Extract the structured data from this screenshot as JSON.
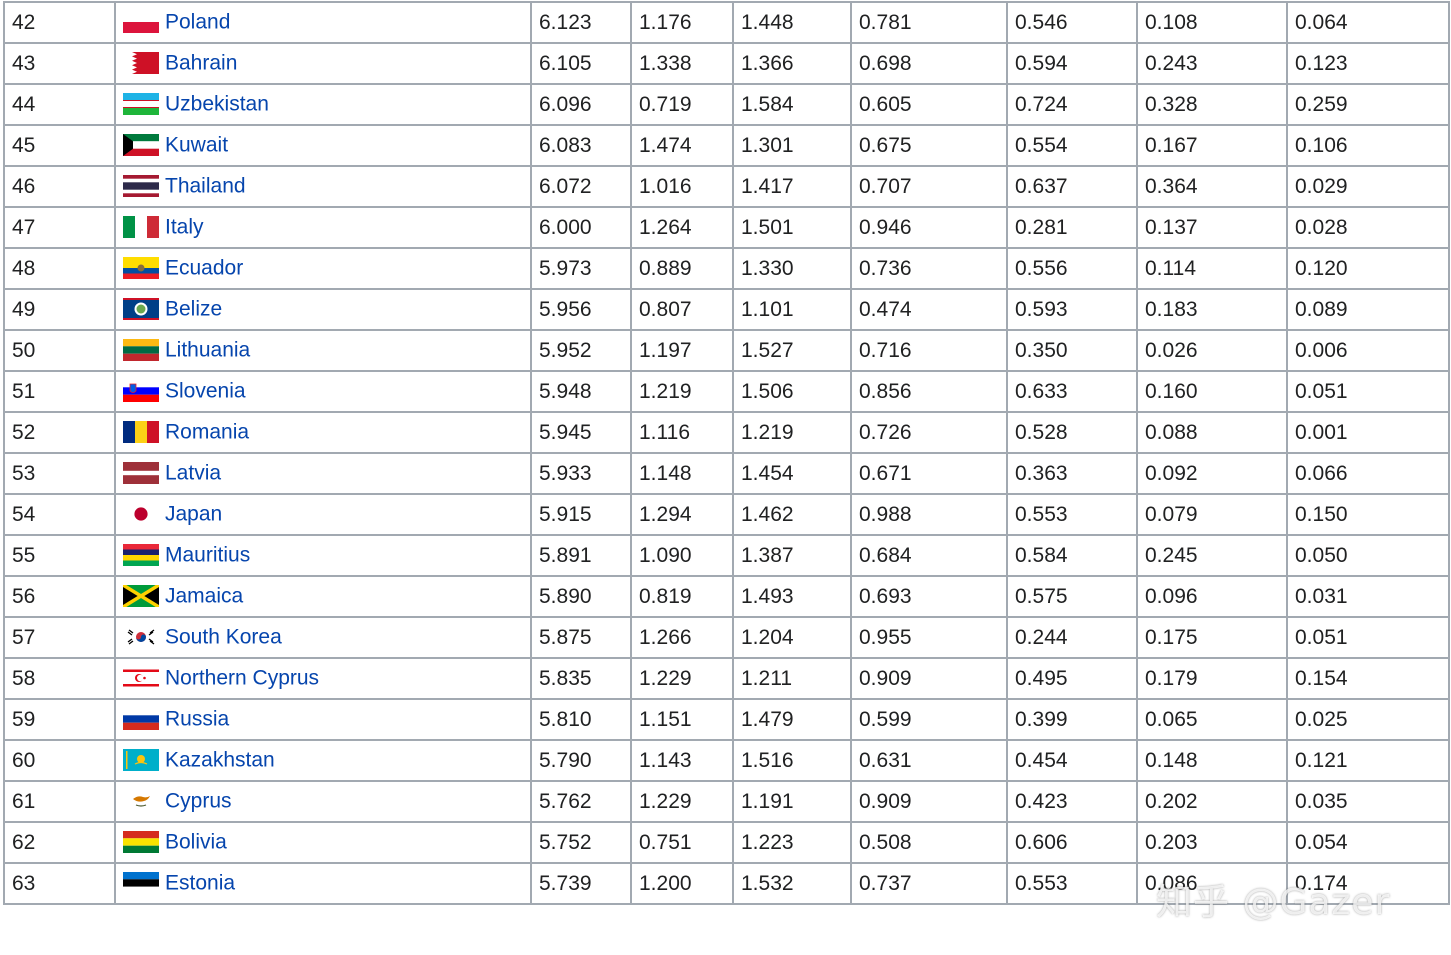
{
  "watermark": "知乎 @Gazer",
  "rows": [
    {
      "rank": "42",
      "country": "Poland",
      "flag": "poland-flag-icon",
      "v": [
        "6.123",
        "1.176",
        "1.448",
        "0.781",
        "0.546",
        "0.108",
        "0.064"
      ]
    },
    {
      "rank": "43",
      "country": "Bahrain",
      "flag": "bahrain-flag-icon",
      "v": [
        "6.105",
        "1.338",
        "1.366",
        "0.698",
        "0.594",
        "0.243",
        "0.123"
      ]
    },
    {
      "rank": "44",
      "country": "Uzbekistan",
      "flag": "uzbekistan-flag-icon",
      "v": [
        "6.096",
        "0.719",
        "1.584",
        "0.605",
        "0.724",
        "0.328",
        "0.259"
      ]
    },
    {
      "rank": "45",
      "country": "Kuwait",
      "flag": "kuwait-flag-icon",
      "v": [
        "6.083",
        "1.474",
        "1.301",
        "0.675",
        "0.554",
        "0.167",
        "0.106"
      ]
    },
    {
      "rank": "46",
      "country": "Thailand",
      "flag": "thailand-flag-icon",
      "v": [
        "6.072",
        "1.016",
        "1.417",
        "0.707",
        "0.637",
        "0.364",
        "0.029"
      ]
    },
    {
      "rank": "47",
      "country": "Italy",
      "flag": "italy-flag-icon",
      "v": [
        "6.000",
        "1.264",
        "1.501",
        "0.946",
        "0.281",
        "0.137",
        "0.028"
      ]
    },
    {
      "rank": "48",
      "country": "Ecuador",
      "flag": "ecuador-flag-icon",
      "v": [
        "5.973",
        "0.889",
        "1.330",
        "0.736",
        "0.556",
        "0.114",
        "0.120"
      ]
    },
    {
      "rank": "49",
      "country": "Belize",
      "flag": "belize-flag-icon",
      "v": [
        "5.956",
        "0.807",
        "1.101",
        "0.474",
        "0.593",
        "0.183",
        "0.089"
      ]
    },
    {
      "rank": "50",
      "country": "Lithuania",
      "flag": "lithuania-flag-icon",
      "v": [
        "5.952",
        "1.197",
        "1.527",
        "0.716",
        "0.350",
        "0.026",
        "0.006"
      ]
    },
    {
      "rank": "51",
      "country": "Slovenia",
      "flag": "slovenia-flag-icon",
      "v": [
        "5.948",
        "1.219",
        "1.506",
        "0.856",
        "0.633",
        "0.160",
        "0.051"
      ]
    },
    {
      "rank": "52",
      "country": "Romania",
      "flag": "romania-flag-icon",
      "v": [
        "5.945",
        "1.116",
        "1.219",
        "0.726",
        "0.528",
        "0.088",
        "0.001"
      ]
    },
    {
      "rank": "53",
      "country": "Latvia",
      "flag": "latvia-flag-icon",
      "v": [
        "5.933",
        "1.148",
        "1.454",
        "0.671",
        "0.363",
        "0.092",
        "0.066"
      ]
    },
    {
      "rank": "54",
      "country": "Japan",
      "flag": "japan-flag-icon",
      "v": [
        "5.915",
        "1.294",
        "1.462",
        "0.988",
        "0.553",
        "0.079",
        "0.150"
      ]
    },
    {
      "rank": "55",
      "country": "Mauritius",
      "flag": "mauritius-flag-icon",
      "v": [
        "5.891",
        "1.090",
        "1.387",
        "0.684",
        "0.584",
        "0.245",
        "0.050"
      ]
    },
    {
      "rank": "56",
      "country": "Jamaica",
      "flag": "jamaica-flag-icon",
      "v": [
        "5.890",
        "0.819",
        "1.493",
        "0.693",
        "0.575",
        "0.096",
        "0.031"
      ]
    },
    {
      "rank": "57",
      "country": "South Korea",
      "flag": "south-korea-flag-icon",
      "v": [
        "5.875",
        "1.266",
        "1.204",
        "0.955",
        "0.244",
        "0.175",
        "0.051"
      ]
    },
    {
      "rank": "58",
      "country": "Northern Cyprus",
      "flag": "northern-cyprus-flag-icon",
      "v": [
        "5.835",
        "1.229",
        "1.211",
        "0.909",
        "0.495",
        "0.179",
        "0.154"
      ]
    },
    {
      "rank": "59",
      "country": "Russia",
      "flag": "russia-flag-icon",
      "v": [
        "5.810",
        "1.151",
        "1.479",
        "0.599",
        "0.399",
        "0.065",
        "0.025"
      ]
    },
    {
      "rank": "60",
      "country": "Kazakhstan",
      "flag": "kazakhstan-flag-icon",
      "v": [
        "5.790",
        "1.143",
        "1.516",
        "0.631",
        "0.454",
        "0.148",
        "0.121"
      ]
    },
    {
      "rank": "61",
      "country": "Cyprus",
      "flag": "cyprus-flag-icon",
      "v": [
        "5.762",
        "1.229",
        "1.191",
        "0.909",
        "0.423",
        "0.202",
        "0.035"
      ]
    },
    {
      "rank": "62",
      "country": "Bolivia",
      "flag": "bolivia-flag-icon",
      "v": [
        "5.752",
        "0.751",
        "1.223",
        "0.508",
        "0.606",
        "0.203",
        "0.054"
      ]
    },
    {
      "rank": "63",
      "country": "Estonia",
      "flag": "estonia-flag-icon",
      "v": [
        "5.739",
        "1.200",
        "1.532",
        "0.737",
        "0.553",
        "0.086",
        "0.174"
      ]
    }
  ]
}
